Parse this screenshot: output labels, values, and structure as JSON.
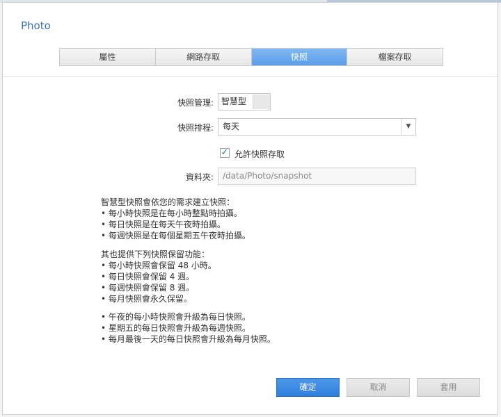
{
  "dialog": {
    "title": "Photo"
  },
  "tabs": [
    {
      "label": "屬性",
      "active": false
    },
    {
      "label": "網路存取",
      "active": false
    },
    {
      "label": "快照",
      "active": true
    },
    {
      "label": "檔案存取",
      "active": false
    }
  ],
  "form": {
    "management_label": "快照管理:",
    "management_value": "智慧型",
    "schedule_label": "快照排程:",
    "schedule_value": "每天",
    "allow_access_checked": true,
    "allow_access_label": "允許快照存取",
    "folder_label": "資料夾:",
    "folder_value": "/data/Photo/snapshot"
  },
  "description": {
    "intro": "智慧型快照會依您的需求建立快照：",
    "intro_items": [
      "• 每小時快照是在每小時整點時拍攝。",
      "• 每日快照是在每天午夜時拍攝。",
      "• 每週快照是在每個星期五午夜時拍攝。"
    ],
    "retention_title": "其也提供下列快照保留功能：",
    "retention_items": [
      "• 每小時快照會保留 48 小時。",
      "• 每日快照會保留 4 週。",
      "• 每週快照會保留 8 週。",
      "• 每月快照會永久保留。"
    ],
    "upgrade_items": [
      "• 午夜的每小時快照會升級為每日快照。",
      "• 星期五的每日快照會升級為每週快照。",
      "• 每月最後一天的每日快照會升級為每月快照。"
    ]
  },
  "buttons": {
    "ok": "確定",
    "cancel": "取消",
    "apply": "套用"
  },
  "colors": {
    "accent": "#3a72b8",
    "tab_active": "#5d9ee8",
    "primary_button": "#2f7fdc"
  }
}
